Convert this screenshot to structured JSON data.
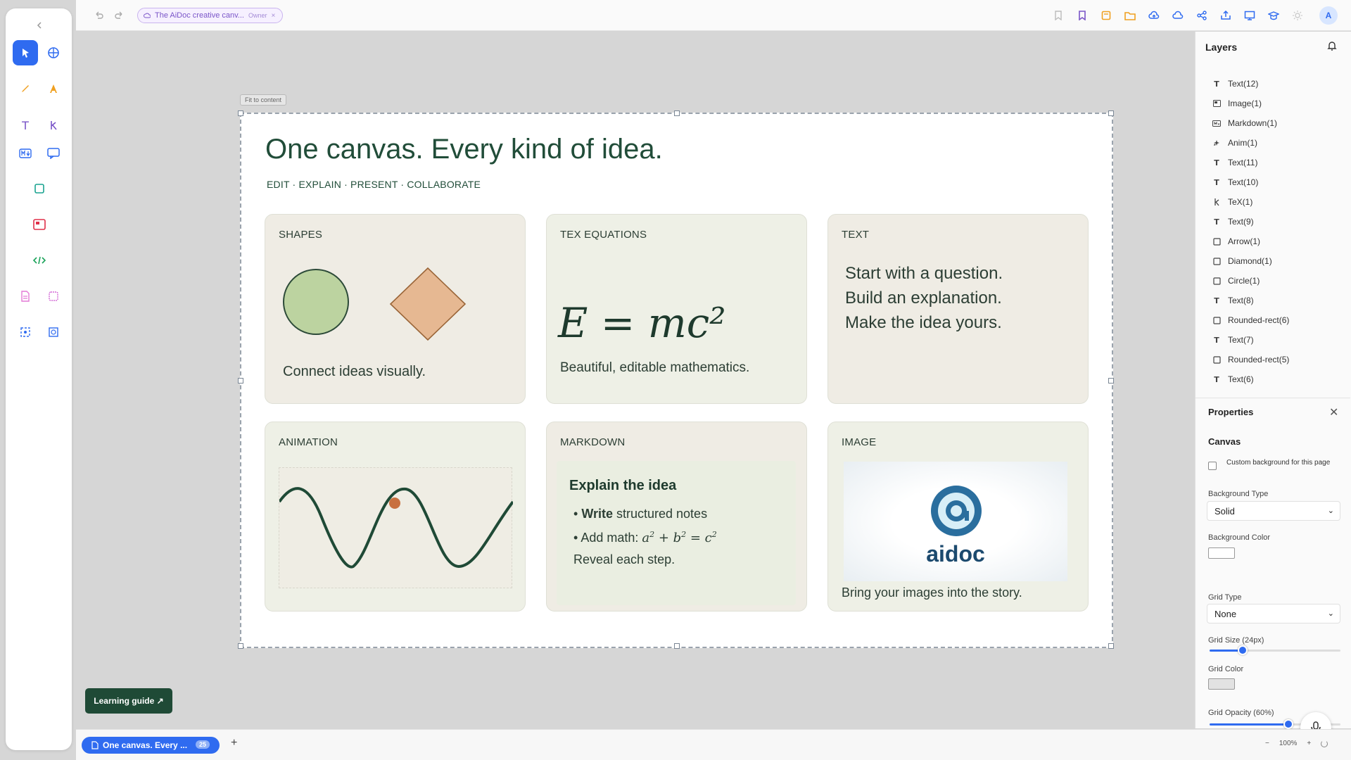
{
  "top_bar": {
    "doc_title": "The AiDoc creative canv...",
    "doc_role": "Owner",
    "avatar_initial": "A"
  },
  "frame": {
    "fit_label": "Fit to content",
    "title": "One canvas. Every kind of idea.",
    "subtitle": "EDIT · EXPLAIN · PRESENT · COLLABORATE",
    "cards": {
      "shapes": {
        "heading": "SHAPES",
        "caption": "Connect ideas visually."
      },
      "tex": {
        "heading": "TEX EQUATIONS",
        "equation": "E = mc²",
        "caption": "Beautiful, editable mathematics."
      },
      "text": {
        "heading": "TEXT",
        "line1": "Start with a question.",
        "line2": "Build an explanation.",
        "line3": "Make the idea yours."
      },
      "animation": {
        "heading": "ANIMATION"
      },
      "markdown": {
        "heading": "MARKDOWN",
        "md_title": "Explain the idea",
        "bullet1_bold": "Write",
        "bullet1_rest": " structured notes",
        "bullet2_prefix": "Add math: ",
        "bullet3": "Reveal each step."
      },
      "image": {
        "heading": "IMAGE",
        "logo_text": "aidoc",
        "caption": "Bring your images into the story."
      }
    }
  },
  "layers_panel": {
    "title": "Layers",
    "items": [
      {
        "icon": "T",
        "label": "Text(12)"
      },
      {
        "icon": "image",
        "label": "Image(1)"
      },
      {
        "icon": "md",
        "label": "Markdown(1)"
      },
      {
        "icon": "anim",
        "label": "Anim(1)"
      },
      {
        "icon": "T",
        "label": "Text(11)"
      },
      {
        "icon": "T",
        "label": "Text(10)"
      },
      {
        "icon": "tex",
        "label": "TeX(1)"
      },
      {
        "icon": "T",
        "label": "Text(9)"
      },
      {
        "icon": "shape",
        "label": "Arrow(1)"
      },
      {
        "icon": "shape",
        "label": "Diamond(1)"
      },
      {
        "icon": "shape",
        "label": "Circle(1)"
      },
      {
        "icon": "T",
        "label": "Text(8)"
      },
      {
        "icon": "shape",
        "label": "Rounded-rect(6)"
      },
      {
        "icon": "T",
        "label": "Text(7)"
      },
      {
        "icon": "shape",
        "label": "Rounded-rect(5)"
      },
      {
        "icon": "T",
        "label": "Text(6)"
      }
    ]
  },
  "properties": {
    "title": "Properties",
    "section": "Canvas",
    "custom_bg_label": "Custom background for this page",
    "custom_bg_checked": false,
    "bg_type_label": "Background Type",
    "bg_type_value": "Solid",
    "bg_color_label": "Background Color",
    "bg_color": "#ffffff",
    "grid_type_label": "Grid Type",
    "grid_type_value": "None",
    "grid_size_label": "Grid Size (24px)",
    "grid_size_fraction": 0.25,
    "grid_color_label": "Grid Color",
    "grid_color": "#e2e2e2",
    "grid_opacity_label": "Grid Opacity (60%)",
    "grid_opacity_fraction": 0.6
  },
  "bottom_bar": {
    "page_label": "One canvas. Every ...",
    "page_count": "25",
    "add_page": "+",
    "zoom_out": "−",
    "zoom_level": "100%",
    "zoom_in": "+"
  },
  "learning_guide": "Learning guide ↗",
  "colors": {
    "accent": "#2f6bf0",
    "heading_green": "#214d39",
    "guide_bg": "#1f4a36"
  }
}
